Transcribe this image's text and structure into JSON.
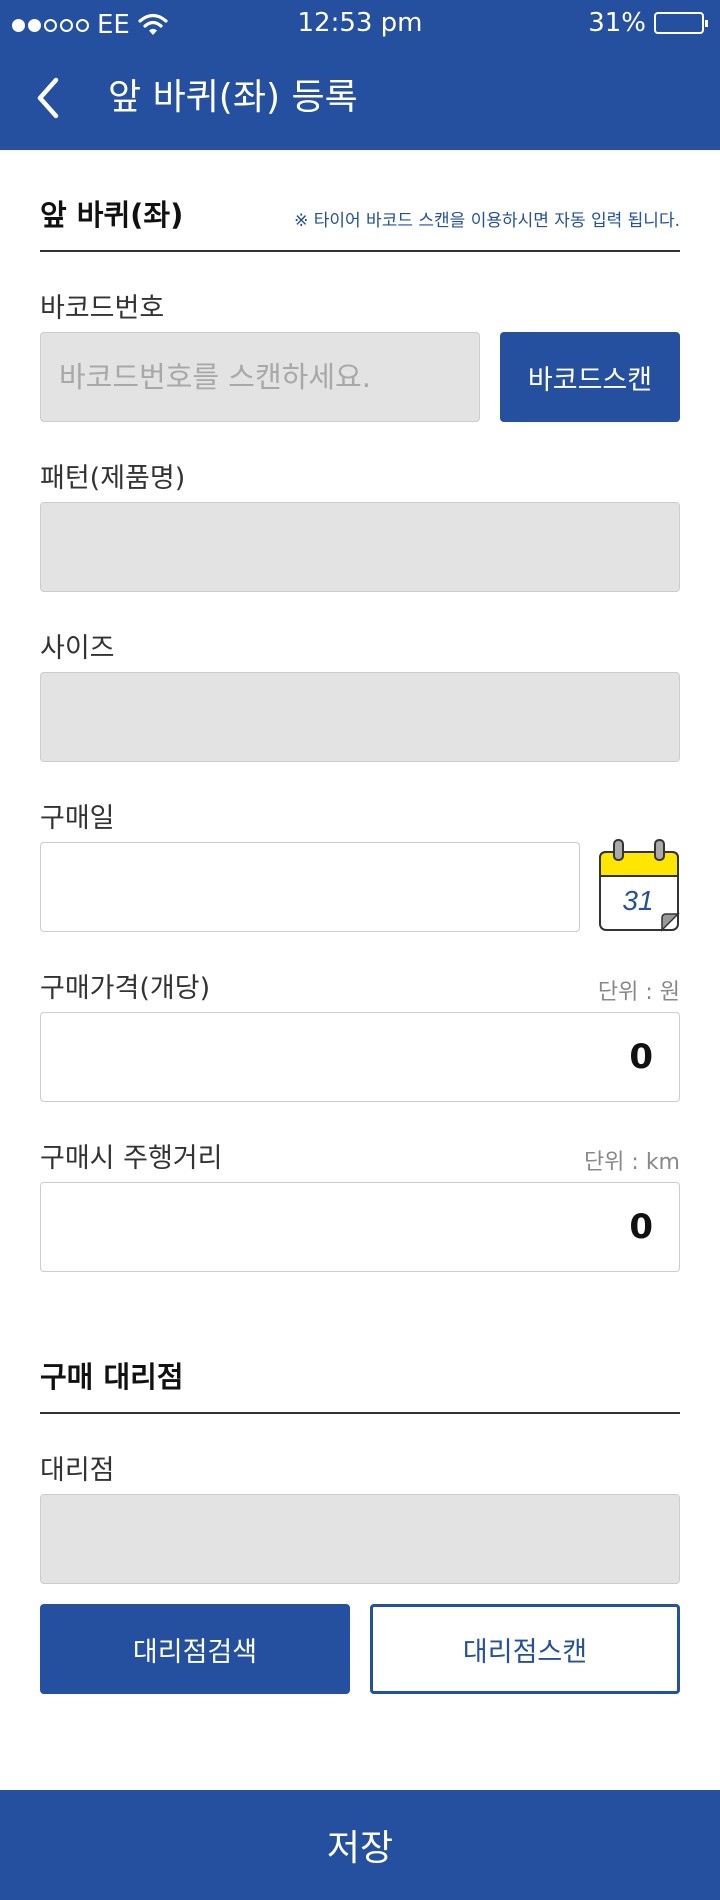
{
  "status_bar": {
    "carrier": "EE",
    "time": "12:53 pm",
    "battery": "31%",
    "icons": [
      "signal-dots-icon",
      "wifi-icon",
      "battery-icon"
    ]
  },
  "header": {
    "title": "앞 바퀴(좌) 등록",
    "back_icon": "chevron-left-icon"
  },
  "tire_section": {
    "title": "앞 바퀴(좌)",
    "note": "※ 타이어 바코드 스캔을 이용하시면 자동 입력 됩니다."
  },
  "barcode": {
    "label": "바코드번호",
    "placeholder": "바코드번호를 스캔하세요.",
    "scan_button": "바코드스캔"
  },
  "pattern": {
    "label": "패턴(제품명)"
  },
  "size": {
    "label": "사이즈"
  },
  "purchase_date": {
    "label": "구매일",
    "calendar_icon": "calendar-icon",
    "calendar_day": "31"
  },
  "price": {
    "label": "구매가격(개당)",
    "unit": "단위 : 원",
    "value": "0"
  },
  "mileage": {
    "label": "구매시 주행거리",
    "unit": "단위 : km",
    "value": "0"
  },
  "dealer_section": {
    "title": "구매 대리점"
  },
  "dealer": {
    "label": "대리점",
    "search_button": "대리점검색",
    "scan_button": "대리점스캔"
  },
  "footer": {
    "save_label": "저장"
  },
  "colors": {
    "primary": "#24509f",
    "readonly_bg": "#e3e3e3",
    "calendar_yellow": "#ffe600"
  }
}
